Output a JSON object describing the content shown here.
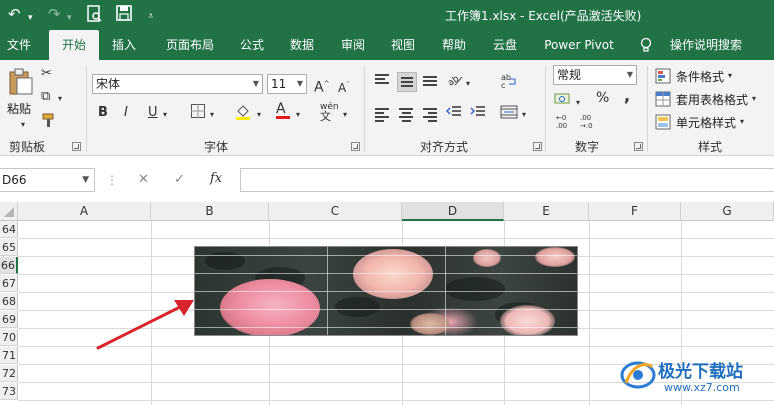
{
  "titlebar": {
    "title": "工作簿1.xlsx  -  Excel(产品激活失败)"
  },
  "tabs": [
    {
      "label": "文件"
    },
    {
      "label": "开始"
    },
    {
      "label": "插入"
    },
    {
      "label": "页面布局"
    },
    {
      "label": "公式"
    },
    {
      "label": "数据"
    },
    {
      "label": "审阅"
    },
    {
      "label": "视图"
    },
    {
      "label": "帮助"
    },
    {
      "label": "云盘"
    },
    {
      "label": "Power Pivot"
    },
    {
      "label": "操作说明搜索"
    }
  ],
  "ribbon": {
    "clipboard": {
      "paste": "粘贴",
      "group": "剪贴板"
    },
    "font": {
      "family": "宋体",
      "size": "11",
      "group": "字体",
      "bold": "B",
      "italic": "I",
      "underline": "U",
      "grow": "A",
      "shrink": "A",
      "fontcolor": "A",
      "phonetic": "wén"
    },
    "align": {
      "group": "对齐方式"
    },
    "number": {
      "format": "常规",
      "group": "数字",
      "percent": "%",
      "comma": ","
    },
    "styles": {
      "cond": "条件格式",
      "table": "套用表格格式",
      "cell": "单元格样式",
      "group": "样式"
    }
  },
  "formula_bar": {
    "namebox": "D66",
    "fx": "fx",
    "cancel": "✕",
    "enter": "✓"
  },
  "grid": {
    "columns": [
      "A",
      "B",
      "C",
      "D",
      "E",
      "F",
      "G"
    ],
    "rows": [
      "64",
      "65",
      "66",
      "67",
      "68",
      "69",
      "70",
      "71",
      "72",
      "73"
    ]
  },
  "watermark": {
    "title": "极光下载站",
    "url": "www.xz7.com"
  },
  "colors": {
    "accent": "#217346",
    "arrow": "#d9242b"
  }
}
